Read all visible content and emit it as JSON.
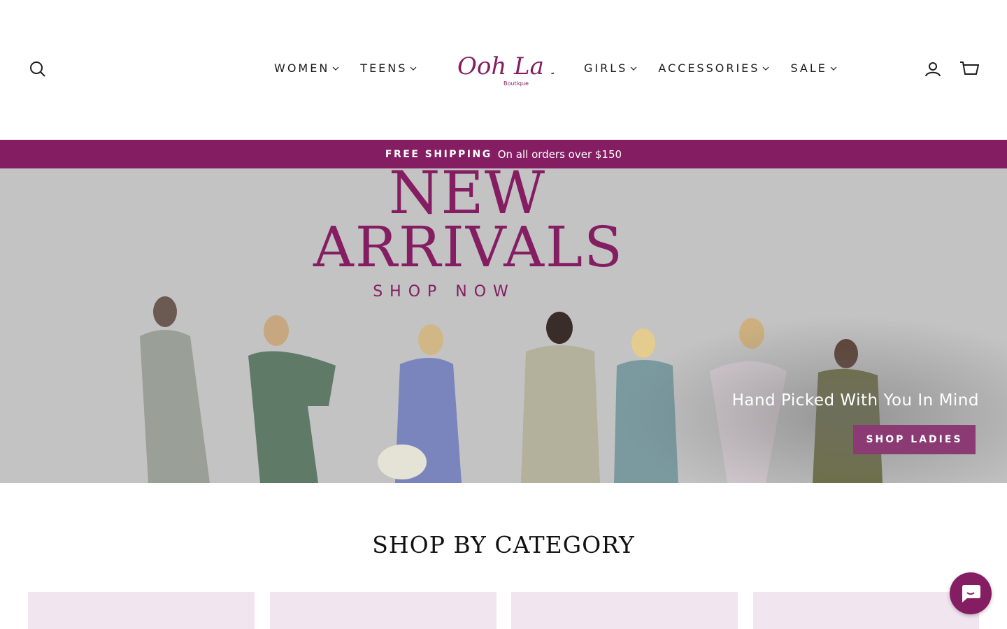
{
  "colors": {
    "brand": "#841d62",
    "hero_bg": "#c3c3c3",
    "card_bg": "#f1e6ef",
    "hero_button": "#8b3a73"
  },
  "header": {
    "nav_left": [
      {
        "label": "WOMEN"
      },
      {
        "label": "TEENS"
      }
    ],
    "nav_right": [
      {
        "label": "GIRLS"
      },
      {
        "label": "ACCESSORIES"
      },
      {
        "label": "SALE"
      }
    ],
    "logo": {
      "text": "Ooh La La",
      "sub": "Boutique"
    },
    "icons": {
      "search": "search-icon",
      "account": "user-icon",
      "cart": "cart-icon"
    }
  },
  "announcement": {
    "strong": "FREE SHIPPING",
    "text": "On all orders over $150"
  },
  "hero": {
    "title_line1": "NEW",
    "title_line2": "ARRIVALS",
    "title_line3": "SHOP NOW",
    "subtitle": "Hand Picked With You In Mind",
    "button_label": "SHOP LADIES"
  },
  "category": {
    "title": "SHOP BY CATEGORY",
    "cards": 4
  },
  "chat": {
    "icon": "chat-icon"
  }
}
